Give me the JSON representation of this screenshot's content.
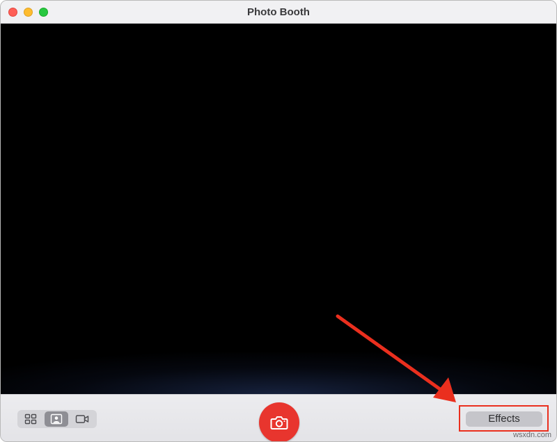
{
  "window": {
    "title": "Photo Booth"
  },
  "traffic_lights": {
    "close_color": "#fe5f57",
    "minimize_color": "#febc2e",
    "maximize_color": "#28c840"
  },
  "toolbar": {
    "view_modes": [
      {
        "icon": "grid-icon",
        "active": false
      },
      {
        "icon": "single-photo-icon",
        "active": true
      },
      {
        "icon": "video-icon",
        "active": false
      }
    ],
    "shutter": {
      "icon": "camera-icon",
      "color": "#e8352e"
    },
    "effects_label": "Effects"
  },
  "annotation": {
    "color": "#ea2f1e",
    "target": "Effects"
  },
  "watermark": "wsxdn.com"
}
